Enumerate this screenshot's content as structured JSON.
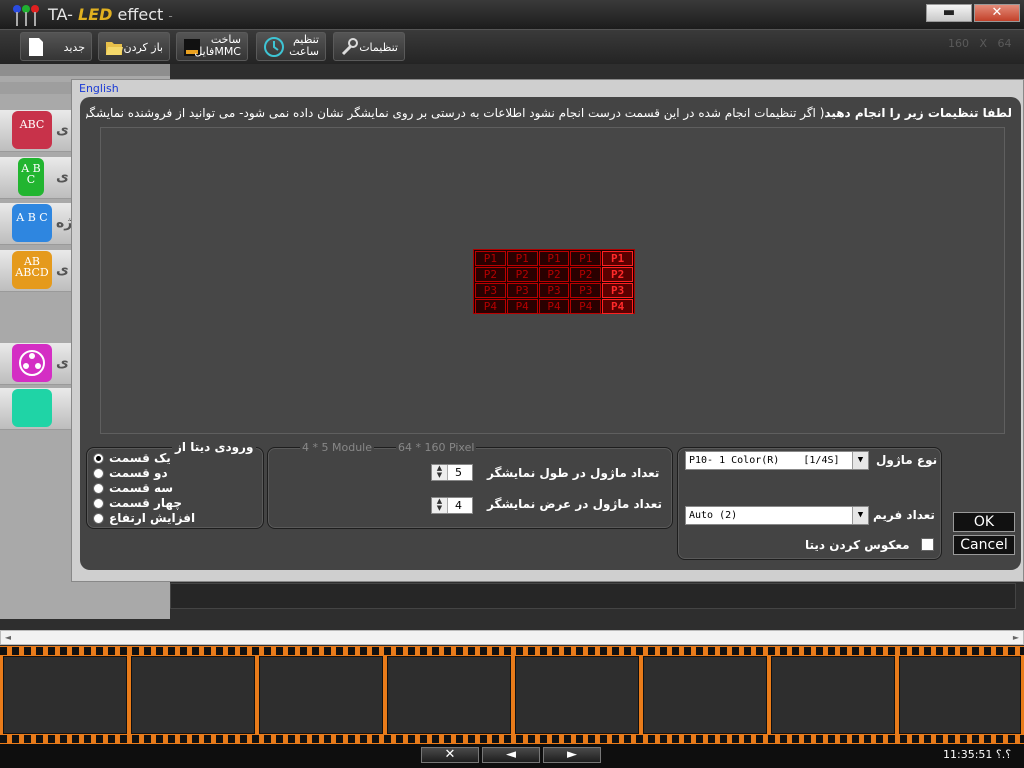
{
  "app": {
    "title_prefix": "TA-",
    "title_logo": "LED",
    "title_suffix": " effect",
    "title_dash": "-",
    "minimize": "▬",
    "close": "✕"
  },
  "toolbar": {
    "settings": "تنظیمات",
    "clock_line1": "تنظیم",
    "clock_line2": "ساعت",
    "mmc_line1": "ساخت",
    "mmc_line2": "فایلMMC",
    "open": "باز کردن",
    "new": "جدید",
    "dims_w": "160",
    "dims_x": "X",
    "dims_h": "64"
  },
  "sidebar": {
    "items": [
      {
        "icon": "abc-icon",
        "icon_text": "ABC",
        "color": "#c8324a",
        "fragment": "ی"
      },
      {
        "icon": "abc-vertical-icon",
        "icon_text": "A B C",
        "color": "#22b530",
        "fragment": "ی"
      },
      {
        "icon": "abc-wave-icon",
        "icon_text": "A B C",
        "color": "#2e86e0",
        "fragment": "یژه"
      },
      {
        "icon": "ab-abcd-icon",
        "icon_text": "AB ABCD",
        "color": "#e59a1c",
        "fragment": "ی"
      },
      {
        "icon": "film-reel-icon",
        "icon_text": "",
        "color": "#d42ec4",
        "fragment": "ی"
      },
      {
        "icon": "blank-tile-icon",
        "icon_text": "",
        "color": "#1fd4a6",
        "fragment": ""
      }
    ]
  },
  "dialog": {
    "language_link": "English",
    "instruction_bold": "لطفا تنظیمات زیر را انجام دهید",
    "instruction_rest": "( اگر تنظیمات انجام شده در این قسمت درست انجام نشود اطلاعات به درستی بر روی نمایشگر نشان داده نمی شود- می توانید از فروشنده نمایشگر راهنمایی بخواهید)",
    "matrix": {
      "rows": [
        [
          "P1",
          "P1",
          "P1",
          "P1",
          "P1"
        ],
        [
          "P2",
          "P2",
          "P2",
          "P2",
          "P2"
        ],
        [
          "P3",
          "P3",
          "P3",
          "P3",
          "P3"
        ],
        [
          "P4",
          "P4",
          "P4",
          "P4",
          "P4"
        ]
      ],
      "highlight_col": 4,
      "color_dim": "#b40000",
      "color_bright": "#ff2a2a"
    },
    "data_input": {
      "legend": "ورودی دیتا از",
      "options": [
        "یک قسمت",
        "دو قسمت",
        "سه قسمت",
        "چهار قسمت",
        "افزایش ارتفاع"
      ],
      "selected": 0
    },
    "count": {
      "module_info": "4 * 5 Module",
      "pixel_info": "64 * 160 Pixel",
      "length_label": "تعداد ماژول در طول نمایشگر",
      "length_value": "5",
      "width_label": "تعداد ماژول در عرض نمایشگر",
      "width_value": "4"
    },
    "module": {
      "type_label": "نوع ماژول",
      "type_value": "P10- 1 Color(R)    [1/4S]",
      "frame_label": "تعداد فریم",
      "frame_value": "Auto (2)",
      "invert_label": "معکوس کردن دیتا",
      "invert_checked": false
    },
    "ok": "OK",
    "cancel": "Cancel"
  },
  "statusbar": {
    "close_glyph": "✕",
    "prev_glyph": "◄",
    "next_glyph": "►",
    "clock": "11:35:51 ؟.؟"
  }
}
